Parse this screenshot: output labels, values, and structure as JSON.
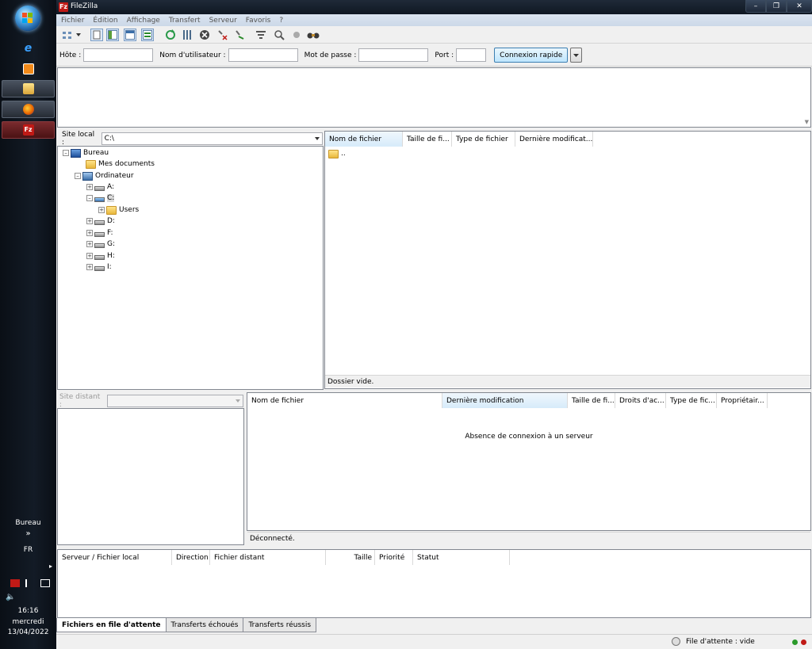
{
  "window": {
    "title": "FileZilla",
    "app_icon": "Fz"
  },
  "menu": [
    "Fichier",
    "Édition",
    "Affichage",
    "Transfert",
    "Serveur",
    "Favoris",
    "?"
  ],
  "quickconnect": {
    "host_label": "Hôte :",
    "user_label": "Nom d'utilisateur :",
    "pass_label": "Mot de passe :",
    "port_label": "Port :",
    "button_label": "Connexion rapide",
    "host_value": "",
    "user_value": "",
    "pass_value": "",
    "port_value": ""
  },
  "local": {
    "site_label": "Site local :",
    "path": "C:\\",
    "tree": [
      {
        "label": "Bureau",
        "icon": "desktop-icon"
      },
      {
        "label": "Mes documents",
        "icon": "folder-icon"
      },
      {
        "label": "Ordinateur",
        "icon": "computer-icon"
      },
      {
        "label": "A:",
        "icon": "floppy-drive-icon"
      },
      {
        "label": "C:",
        "icon": "system-drive-icon"
      },
      {
        "label": "Users",
        "icon": "folder-icon"
      },
      {
        "label": "D:",
        "icon": "cd-drive-icon"
      },
      {
        "label": "F:",
        "icon": "drive-icon"
      },
      {
        "label": "G:",
        "icon": "drive-icon"
      },
      {
        "label": "H:",
        "icon": "drive-icon"
      },
      {
        "label": "I:",
        "icon": "drive-icon"
      }
    ],
    "columns": [
      "Nom de fichier",
      "Taille de fi...",
      "Type de fichier",
      "Dernière modificat..."
    ],
    "rows": [
      ".."
    ],
    "status": "Dossier vide."
  },
  "remote": {
    "site_label": "Site distant :",
    "path": "",
    "columns": [
      "Nom de fichier",
      "Dernière modification",
      "Taille de fi...",
      "Droits d'ac...",
      "Type de fic...",
      "Propriétair..."
    ],
    "empty_message": "Absence de connexion à un serveur",
    "status": "Déconnecté."
  },
  "queue": {
    "columns": [
      "Serveur / Fichier local",
      "Direction",
      "Fichier distant",
      "Taille",
      "Priorité",
      "Statut"
    ],
    "tabs": [
      "Fichiers en file d'attente",
      "Transferts échoués",
      "Transferts réussis"
    ],
    "status": "File d'attente : vide"
  },
  "taskbar": {
    "desktop_label": "Bureau",
    "chevron": "»",
    "lang": "FR",
    "time": "16:16",
    "day": "mercredi",
    "date": "13/04/2022",
    "arrow": "▸"
  },
  "colors": {
    "accent": "#3c7fb1",
    "filezilla_red": "#c01a16",
    "taskbar_bg": "#0b1018"
  }
}
